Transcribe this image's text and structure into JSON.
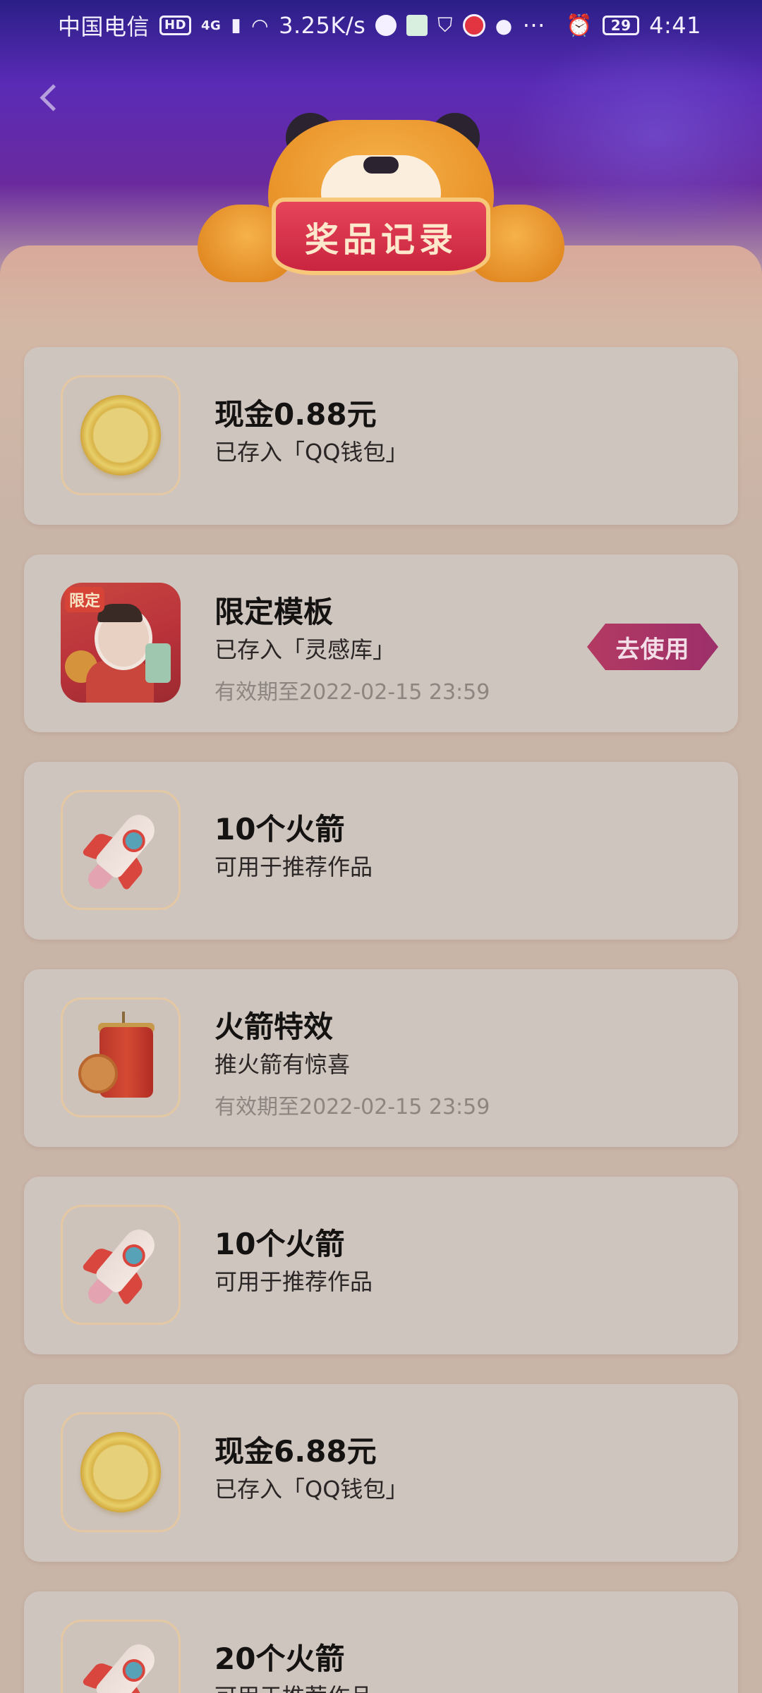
{
  "status_bar": {
    "carrier": "中国电信",
    "hd_label": "HD",
    "network": "4G",
    "speed": "3.25K/s",
    "battery": "29",
    "time": "4:41",
    "more": "···"
  },
  "header": {
    "title": "奖品记录"
  },
  "records": [
    {
      "title": "现金0.88元",
      "subtitle": "已存入「QQ钱包」",
      "icon": "coin-icon"
    },
    {
      "title": "限定模板",
      "subtitle": "已存入「灵感库」",
      "expire": "有效期至2022-02-15 23:59",
      "icon": "template-image",
      "tag": "限定",
      "action_label": "去使用"
    },
    {
      "title": "10个火箭",
      "subtitle": "可用于推荐作品",
      "icon": "rocket-icon"
    },
    {
      "title": "火箭特效",
      "subtitle": "推火箭有惊喜",
      "expire": "有效期至2022-02-15 23:59",
      "icon": "firecracker-icon"
    },
    {
      "title": "10个火箭",
      "subtitle": "可用于推荐作品",
      "icon": "rocket-icon"
    },
    {
      "title": "现金6.88元",
      "subtitle": "已存入「QQ钱包」",
      "icon": "coin-icon"
    },
    {
      "title": "20个火箭",
      "subtitle": "可用于推荐作品",
      "icon": "rocket-icon"
    }
  ],
  "colors": {
    "accent_button": "#b33a62",
    "banner_red": "#c92440",
    "card_bg": "#cfc5bf"
  }
}
